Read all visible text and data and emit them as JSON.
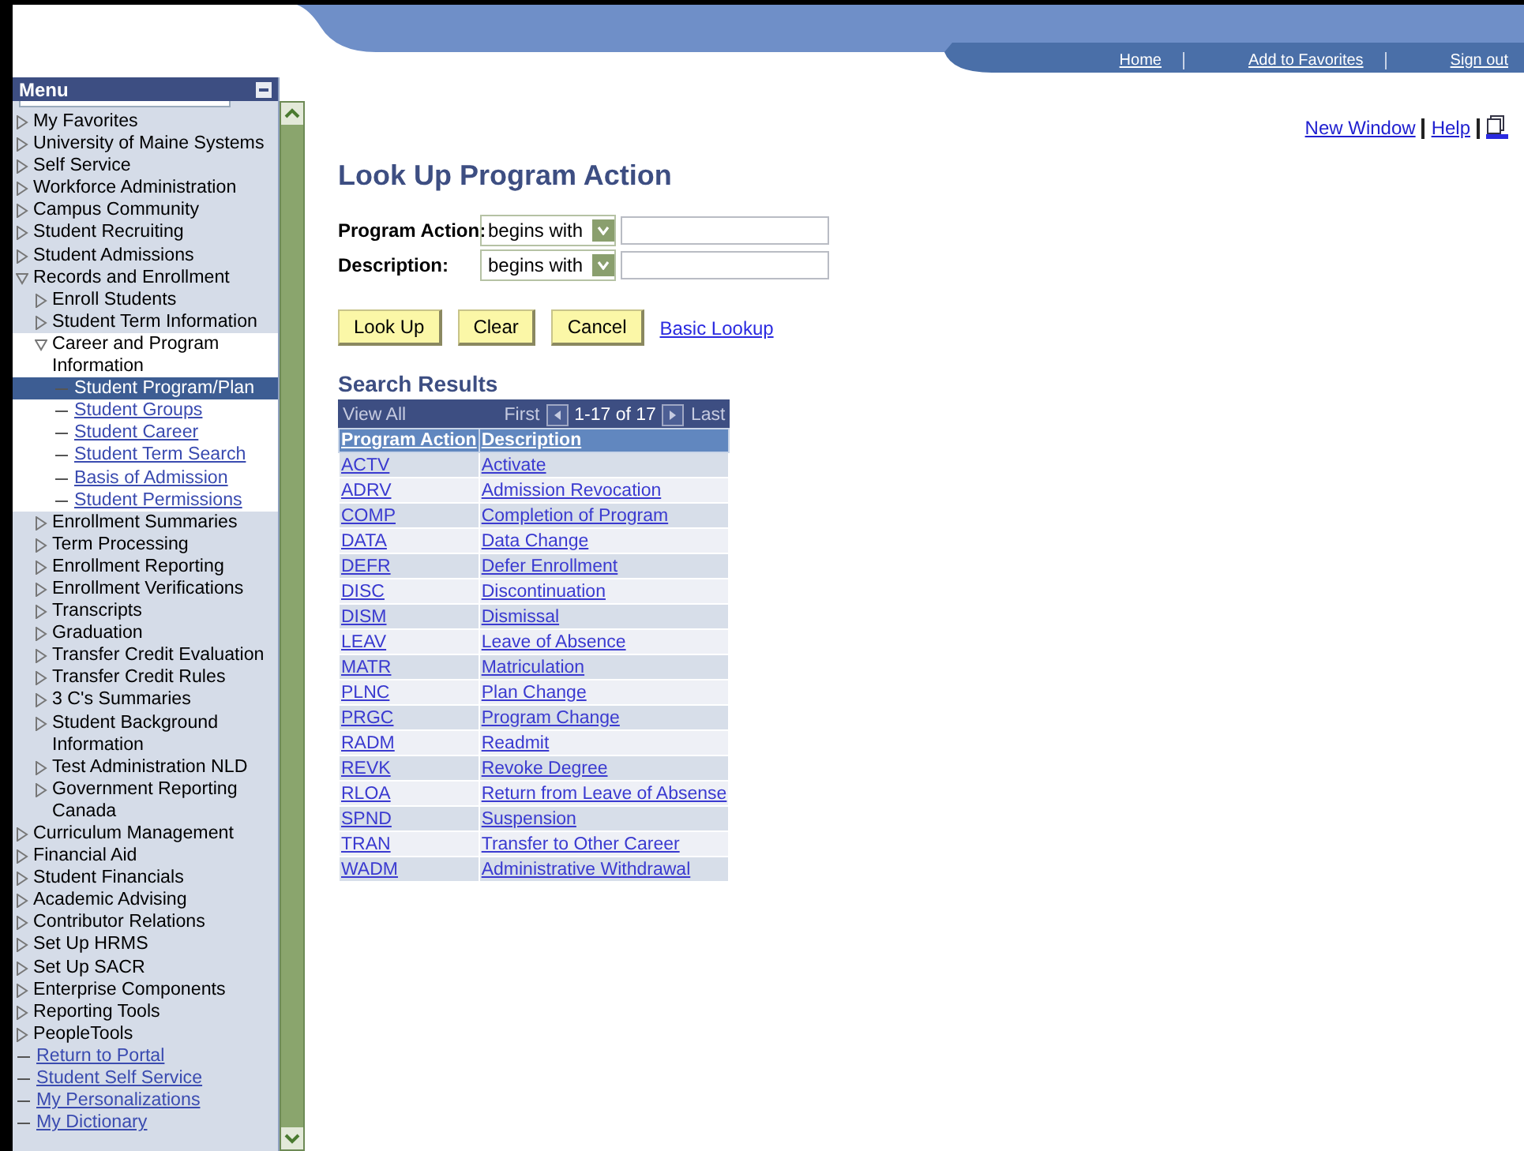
{
  "header": {
    "links": [
      "Home",
      "Add to Favorites",
      "Sign out"
    ]
  },
  "menu": {
    "title": "Menu",
    "items": [
      {
        "kind": "folder",
        "label": "My Favorites",
        "expanded": false
      },
      {
        "kind": "folder",
        "label": "University of Maine Systems",
        "expanded": false
      },
      {
        "kind": "folder",
        "label": "Self Service",
        "expanded": false
      },
      {
        "kind": "folder",
        "label": "Workforce Administration",
        "expanded": false
      },
      {
        "kind": "folder",
        "label": "Campus Community",
        "expanded": false
      },
      {
        "kind": "folder",
        "label": "Student Recruiting",
        "expanded": false
      },
      {
        "kind": "folder",
        "label": "Student Admissions",
        "expanded": false
      },
      {
        "kind": "folder",
        "label": "Records and Enrollment",
        "expanded": true,
        "children": [
          {
            "kind": "folder",
            "label": "Enroll Students",
            "expanded": false
          },
          {
            "kind": "folder",
            "label": "Student Term Information",
            "expanded": false
          },
          {
            "kind": "folder",
            "label": "Career and Program Information",
            "expanded": true,
            "children": [
              {
                "kind": "link",
                "label": "Student Program/Plan",
                "selected": true
              },
              {
                "kind": "link",
                "label": "Student Groups",
                "selected": false
              },
              {
                "kind": "link",
                "label": "Student Career",
                "selected": false
              },
              {
                "kind": "link",
                "label": "Student Term Search",
                "selected": false
              },
              {
                "kind": "link",
                "label": "Basis of Admission",
                "selected": false
              },
              {
                "kind": "link",
                "label": "Student Permissions",
                "selected": false
              }
            ]
          },
          {
            "kind": "folder",
            "label": "Enrollment Summaries",
            "expanded": false
          },
          {
            "kind": "folder",
            "label": "Term Processing",
            "expanded": false
          },
          {
            "kind": "folder",
            "label": "Enrollment Reporting",
            "expanded": false
          },
          {
            "kind": "folder",
            "label": "Enrollment Verifications",
            "expanded": false
          },
          {
            "kind": "folder",
            "label": "Transcripts",
            "expanded": false
          },
          {
            "kind": "folder",
            "label": "Graduation",
            "expanded": false
          },
          {
            "kind": "folder",
            "label": "Transfer Credit Evaluation",
            "expanded": false
          },
          {
            "kind": "folder",
            "label": "Transfer Credit Rules",
            "expanded": false
          },
          {
            "kind": "folder",
            "label": "3 C's Summaries",
            "expanded": false
          },
          {
            "kind": "folder",
            "label": "Student Background Information",
            "expanded": false
          },
          {
            "kind": "folder",
            "label": "Test Administration NLD",
            "expanded": false
          },
          {
            "kind": "folder",
            "label": "Government Reporting Canada",
            "expanded": false
          }
        ]
      },
      {
        "kind": "folder",
        "label": "Curriculum Management",
        "expanded": false
      },
      {
        "kind": "folder",
        "label": "Financial Aid",
        "expanded": false
      },
      {
        "kind": "folder",
        "label": "Student Financials",
        "expanded": false
      },
      {
        "kind": "folder",
        "label": "Academic Advising",
        "expanded": false
      },
      {
        "kind": "folder",
        "label": "Contributor Relations",
        "expanded": false
      },
      {
        "kind": "folder",
        "label": "Set Up HRMS",
        "expanded": false
      },
      {
        "kind": "folder",
        "label": "Set Up SACR",
        "expanded": false
      },
      {
        "kind": "folder",
        "label": "Enterprise Components",
        "expanded": false
      },
      {
        "kind": "folder",
        "label": "Reporting Tools",
        "expanded": false
      },
      {
        "kind": "folder",
        "label": "PeopleTools",
        "expanded": false
      },
      {
        "kind": "link",
        "label": "Return to Portal",
        "selected": false
      },
      {
        "kind": "link",
        "label": "Student Self Service",
        "selected": false
      },
      {
        "kind": "link",
        "label": "My Personalizations",
        "selected": false
      },
      {
        "kind": "link",
        "label": "My Dictionary",
        "selected": false
      }
    ]
  },
  "top_links": [
    "New Window",
    "Help"
  ],
  "title": "Look Up Program Action",
  "criteria": [
    {
      "label": "Program Action:",
      "operator": "begins with"
    },
    {
      "label": "Description:",
      "operator": "begins with"
    }
  ],
  "buttons": [
    "Look Up",
    "Clear",
    "Cancel"
  ],
  "basic_lookup": "Basic Lookup",
  "results": {
    "title": "Search Results",
    "view_all": "View All",
    "first": "First",
    "range": "1-17 of 17",
    "last": "Last",
    "columns": [
      "Program Action",
      "Description"
    ],
    "rows": [
      [
        "ACTV",
        "Activate"
      ],
      [
        "ADRV",
        "Admission Revocation"
      ],
      [
        "COMP",
        "Completion of Program"
      ],
      [
        "DATA",
        "Data Change"
      ],
      [
        "DEFR",
        "Defer Enrollment"
      ],
      [
        "DISC",
        "Discontinuation"
      ],
      [
        "DISM",
        "Dismissal"
      ],
      [
        "LEAV",
        "Leave of Absence"
      ],
      [
        "MATR",
        "Matriculation"
      ],
      [
        "PLNC",
        "Plan Change"
      ],
      [
        "PRGC",
        "Program Change"
      ],
      [
        "RADM",
        "Readmit"
      ],
      [
        "REVK",
        "Revoke Degree"
      ],
      [
        "RLOA",
        "Return from Leave of Absense"
      ],
      [
        "SPND",
        "Suspension"
      ],
      [
        "TRAN",
        "Transfer to Other Career"
      ],
      [
        "WADM",
        "Administrative Withdrawal"
      ]
    ]
  }
}
